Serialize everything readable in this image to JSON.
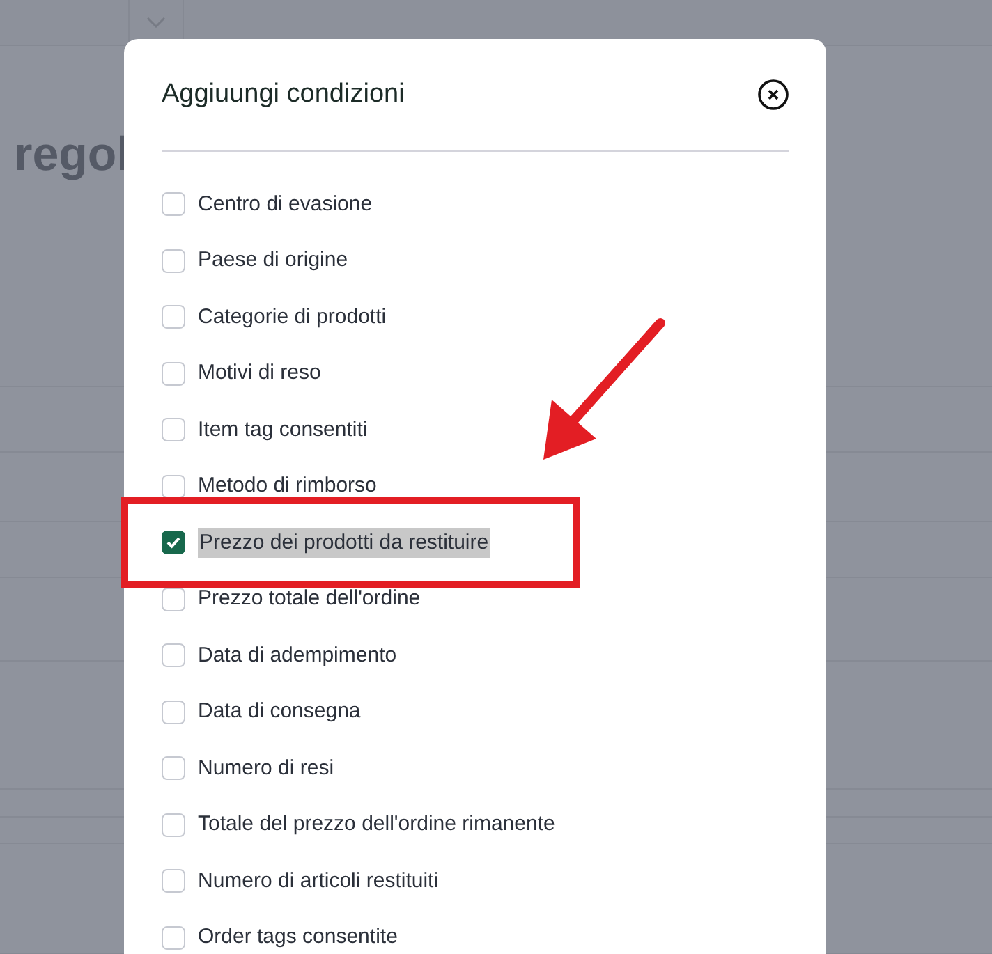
{
  "background": {
    "heading": "regol"
  },
  "dialog": {
    "title": "Aggiuungi condizioni",
    "options": [
      {
        "label": "Centro di evasione",
        "checked": false,
        "highlighted": false
      },
      {
        "label": "Paese di origine",
        "checked": false,
        "highlighted": false
      },
      {
        "label": "Categorie di prodotti",
        "checked": false,
        "highlighted": false
      },
      {
        "label": "Motivi di reso",
        "checked": false,
        "highlighted": false
      },
      {
        "label": "Item tag consentiti",
        "checked": false,
        "highlighted": false
      },
      {
        "label": "Metodo di rimborso",
        "checked": false,
        "highlighted": false
      },
      {
        "label": "Prezzo dei prodotti da restituire",
        "checked": true,
        "highlighted": true
      },
      {
        "label": "Prezzo totale dell'ordine",
        "checked": false,
        "highlighted": false
      },
      {
        "label": "Data di adempimento",
        "checked": false,
        "highlighted": false
      },
      {
        "label": "Data di consegna",
        "checked": false,
        "highlighted": false
      },
      {
        "label": "Numero di resi",
        "checked": false,
        "highlighted": false
      },
      {
        "label": "Totale del prezzo dell'ordine rimanente",
        "checked": false,
        "highlighted": false
      },
      {
        "label": "Numero di articoli restituiti",
        "checked": false,
        "highlighted": false
      },
      {
        "label": "Order tags consentite",
        "checked": false,
        "highlighted": false
      }
    ]
  }
}
